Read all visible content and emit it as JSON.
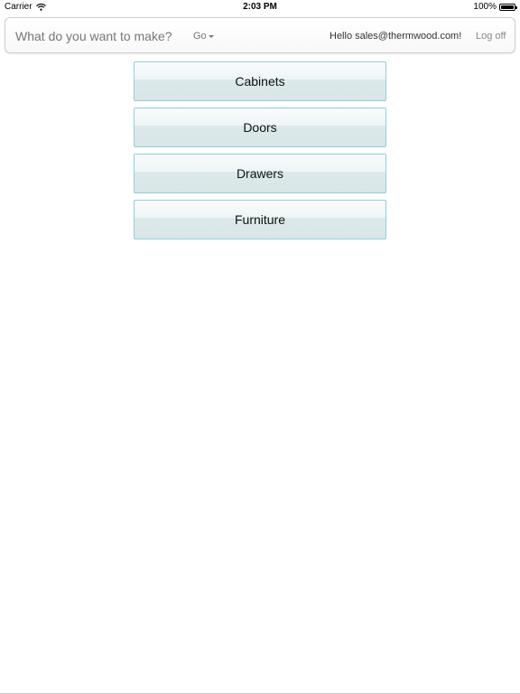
{
  "status_bar": {
    "carrier": "Carrier",
    "wifi_icon": "wifi-icon",
    "time": "2:03 PM",
    "battery_percent": "100%",
    "battery_level": 1.0,
    "battery_icon": "battery-icon"
  },
  "navbar": {
    "brand": "What do you want to make?",
    "go_label": "Go",
    "go_caret_icon": "caret-down-icon",
    "greeting": "Hello sales@thermwood.com!",
    "logoff_label": "Log off"
  },
  "menu": {
    "items": [
      {
        "label": "Cabinets"
      },
      {
        "label": "Doors"
      },
      {
        "label": "Drawers"
      },
      {
        "label": "Furniture"
      }
    ]
  },
  "colors": {
    "button_border": "#8fcde0",
    "button_gradient_top": "#fbfcfc",
    "button_gradient_bottom": "#d9e6e7",
    "navbar_text": "#777777"
  }
}
